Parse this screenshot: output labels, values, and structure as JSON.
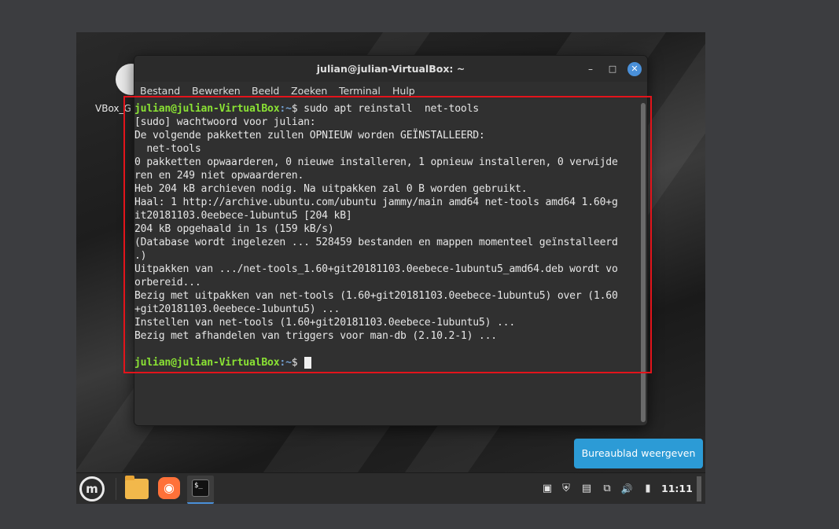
{
  "desktop": {
    "icon_label": "VBox_G"
  },
  "window": {
    "title": "julian@julian-VirtualBox: ~",
    "minimize_glyph": "–",
    "maximize_glyph": "□",
    "close_glyph": "✕"
  },
  "menu": {
    "items": [
      "Bestand",
      "Bewerken",
      "Beeld",
      "Zoeken",
      "Terminal",
      "Hulp"
    ]
  },
  "terminal": {
    "prompt_user": "julian@julian-VirtualBox",
    "prompt_path": ":~",
    "prompt_symbol": "$ ",
    "command": "sudo apt reinstall  net-tools",
    "output": [
      "[sudo] wachtwoord voor julian:",
      "De volgende pakketten zullen OPNIEUW worden GEÏNSTALLEERD:",
      "  net-tools",
      "0 pakketten opwaarderen, 0 nieuwe installeren, 1 opnieuw installeren, 0 verwijde",
      "ren en 249 niet opwaarderen.",
      "Heb 204 kB archieven nodig. Na uitpakken zal 0 B worden gebruikt.",
      "Haal: 1 http://archive.ubuntu.com/ubuntu jammy/main amd64 net-tools amd64 1.60+g",
      "it20181103.0eebece-1ubuntu5 [204 kB]",
      "204 kB opgehaald in 1s (159 kB/s)",
      "(Database wordt ingelezen ... 528459 bestanden en mappen momenteel geïnstalleerd",
      ".)",
      "Uitpakken van .../net-tools_1.60+git20181103.0eebece-1ubuntu5_amd64.deb wordt vo",
      "orbereid...",
      "Bezig met uitpakken van net-tools (1.60+git20181103.0eebece-1ubuntu5) over (1.60",
      "+git20181103.0eebece-1ubuntu5) ...",
      "Instellen van net-tools (1.60+git20181103.0eebece-1ubuntu5) ...",
      "Bezig met afhandelen van triggers voor man-db (2.10.2-1) ..."
    ]
  },
  "toast": {
    "label": "Bureaublad weergeven"
  },
  "taskbar": {
    "menu_glyph": "m",
    "firefox_glyph": "◉",
    "terminal_glyph": "$_",
    "tray_icons": [
      {
        "name": "clipboard-icon",
        "glyph": "▣"
      },
      {
        "name": "shield-icon",
        "glyph": "⛨"
      },
      {
        "name": "update-icon",
        "glyph": "▤"
      },
      {
        "name": "network-icon",
        "glyph": "⧉"
      },
      {
        "name": "volume-icon",
        "glyph": "🔊"
      },
      {
        "name": "battery-icon",
        "glyph": "▮"
      }
    ],
    "clock": "11:11"
  },
  "colors": {
    "prompt_user": "#8ae234",
    "prompt_path": "#729fcf",
    "highlight": "#e3141b",
    "toast_bg": "#2c9bd6"
  }
}
